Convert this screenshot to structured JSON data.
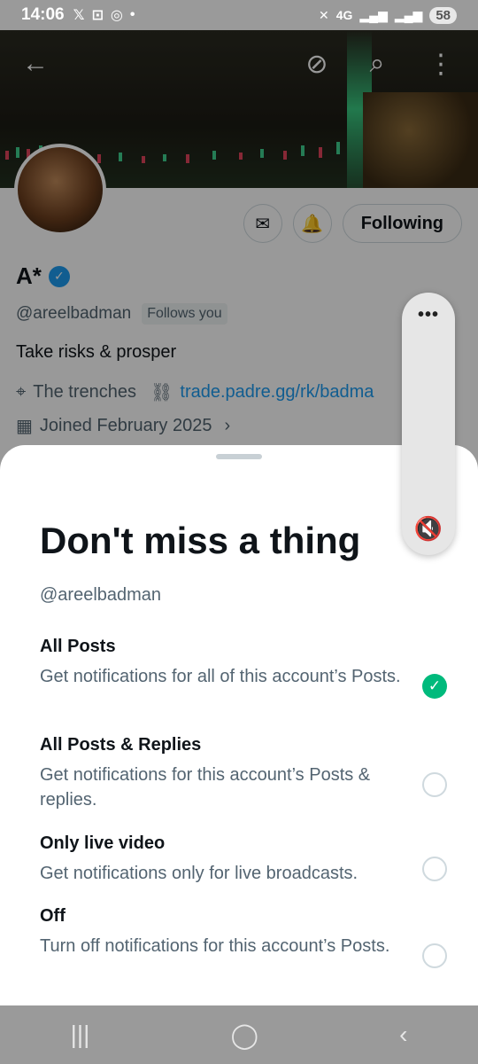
{
  "status_bar": {
    "time": "14:06",
    "left_icons": [
      "x-icon",
      "screenshot-icon",
      "whatsapp-icon",
      "dot-icon"
    ],
    "network": "4G",
    "battery": "58"
  },
  "profile": {
    "name": "A*",
    "handle": "@areelbadman",
    "follows_you": "Follows you",
    "bio": "Take risks & prosper",
    "location": "The trenches",
    "link": "trade.padre.gg/rk/badma",
    "joined": "Joined February 2025",
    "following_label": "Following"
  },
  "sheet": {
    "title": "Don't miss a thing",
    "handle": "@areelbadman",
    "options": [
      {
        "title": "All Posts",
        "desc": "Get notifications for all of this account’s Posts.",
        "checked": true
      },
      {
        "title": "All Posts & Replies",
        "desc": "Get notifications for this account’s Posts & replies.",
        "checked": false
      },
      {
        "title": "Only live video",
        "desc": "Get notifications only for live broadcasts.",
        "checked": false
      },
      {
        "title": "Off",
        "desc": "Turn off notifications for this account’s Posts.",
        "checked": false
      }
    ]
  },
  "volume_panel": {
    "menu_glyph": "•••",
    "mute_glyph": "🔇"
  },
  "colors": {
    "accent": "#1d9bf0",
    "check": "#00ba7c",
    "text": "#0f1419",
    "secondary": "#536471"
  }
}
